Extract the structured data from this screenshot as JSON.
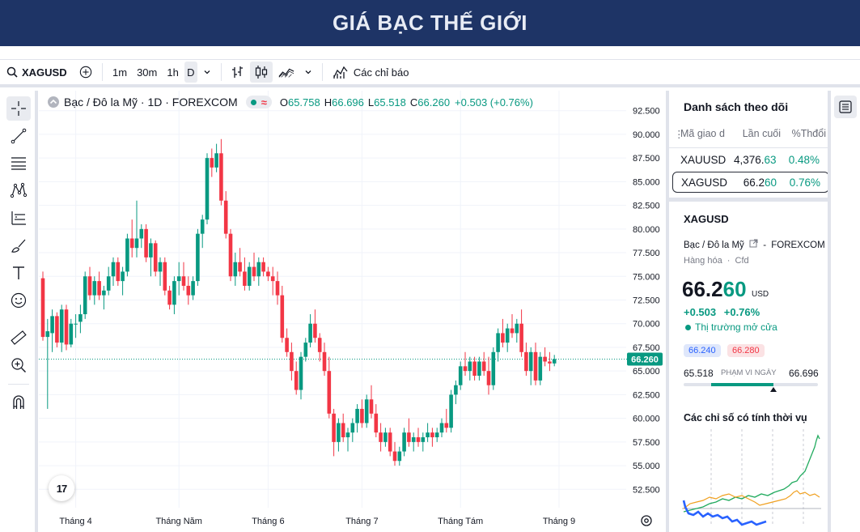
{
  "banner": {
    "title": "GIÁ BẠC THẾ GIỚI"
  },
  "toolbar": {
    "symbol": "XAGUSD",
    "intervals": [
      "1m",
      "30m",
      "1h",
      "D"
    ],
    "active_interval": "D",
    "indicators_label": "Các chỉ báo"
  },
  "legend": {
    "name": "Bạc / Đô la Mỹ · 1D · FOREXCOM",
    "o_label": "O",
    "o": "65.758",
    "h_label": "H",
    "h": "66.696",
    "l_label": "L",
    "l": "65.518",
    "c_label": "C",
    "c": "66.260",
    "change": "+0.503 (+0.76%)"
  },
  "colors": {
    "up": "#089981",
    "down": "#f23645",
    "banner": "#1e3466",
    "accent": "#2962ff"
  },
  "chart_data": {
    "type": "candlestick",
    "y_ticks": [
      "92.500",
      "90.000",
      "87.500",
      "85.000",
      "82.500",
      "80.000",
      "77.500",
      "75.000",
      "72.500",
      "70.000",
      "67.500",
      "65.000",
      "62.500",
      "60.000",
      "57.500",
      "55.000",
      "52.500"
    ],
    "ylim": [
      51.5,
      93.5
    ],
    "x_ticks": [
      "Tháng 4",
      "Tháng Năm",
      "Tháng 6",
      "Tháng 7",
      "Tháng Tám",
      "Tháng 9"
    ],
    "x_tick_index": [
      7,
      29,
      48,
      68,
      89,
      110
    ],
    "last_price": "66.260",
    "last_value": 66.26,
    "grid": true,
    "ohlc": [
      [
        74.8,
        75.5,
        68.2,
        68.6
      ],
      [
        68.6,
        70.5,
        61.0,
        69.2
      ],
      [
        69.0,
        71.5,
        67.0,
        70.8
      ],
      [
        70.8,
        71.2,
        67.5,
        68.0
      ],
      [
        68.0,
        72.0,
        67.0,
        71.5
      ],
      [
        71.5,
        72.0,
        67.2,
        67.8
      ],
      [
        67.8,
        70.5,
        67.5,
        70.0
      ],
      [
        70.0,
        71.0,
        68.5,
        70.0
      ],
      [
        70.2,
        72.0,
        69.0,
        71.0
      ],
      [
        71.0,
        75.5,
        70.5,
        75.0
      ],
      [
        75.0,
        76.0,
        72.5,
        73.0
      ],
      [
        73.0,
        75.0,
        72.0,
        74.5
      ],
      [
        74.5,
        75.5,
        72.5,
        73.0
      ],
      [
        73.0,
        74.0,
        71.5,
        73.5
      ],
      [
        73.5,
        76.0,
        73.0,
        75.0
      ],
      [
        75.0,
        77.0,
        74.0,
        76.5
      ],
      [
        76.5,
        77.0,
        74.0,
        74.5
      ],
      [
        74.5,
        76.0,
        73.0,
        75.5
      ],
      [
        75.5,
        79.5,
        75.0,
        79.0
      ],
      [
        79.0,
        81.0,
        77.0,
        78.0
      ],
      [
        78.0,
        83.0,
        77.0,
        79.0
      ],
      [
        79.0,
        80.5,
        78.0,
        80.0
      ],
      [
        80.0,
        80.5,
        76.5,
        77.0
      ],
      [
        77.0,
        79.0,
        75.0,
        78.5
      ],
      [
        78.5,
        78.8,
        75.0,
        75.5
      ],
      [
        75.5,
        77.0,
        74.0,
        76.5
      ],
      [
        76.5,
        77.0,
        73.0,
        73.5
      ],
      [
        73.5,
        74.0,
        71.5,
        72.0
      ],
      [
        72.0,
        75.0,
        71.0,
        74.5
      ],
      [
        74.5,
        76.5,
        73.0,
        75.0
      ],
      [
        75.0,
        76.5,
        73.5,
        74.0
      ],
      [
        74.0,
        75.0,
        72.0,
        73.0
      ],
      [
        73.0,
        75.0,
        72.5,
        74.5
      ],
      [
        74.5,
        80.0,
        74.0,
        79.5
      ],
      [
        79.5,
        81.5,
        78.0,
        81.0
      ],
      [
        81.0,
        88.0,
        80.5,
        87.5
      ],
      [
        87.5,
        88.5,
        85.5,
        86.5
      ],
      [
        86.5,
        89.0,
        86.0,
        88.0
      ],
      [
        88.0,
        89.5,
        82.5,
        83.0
      ],
      [
        83.0,
        84.0,
        79.0,
        79.5
      ],
      [
        79.5,
        80.0,
        74.5,
        75.0
      ],
      [
        75.0,
        77.5,
        74.0,
        76.5
      ],
      [
        76.5,
        78.0,
        75.0,
        75.5
      ],
      [
        75.5,
        77.0,
        73.5,
        74.0
      ],
      [
        74.0,
        76.5,
        73.5,
        76.0
      ],
      [
        76.0,
        77.5,
        74.5,
        75.0
      ],
      [
        75.0,
        77.0,
        74.0,
        76.5
      ],
      [
        76.5,
        77.0,
        75.0,
        75.5
      ],
      [
        75.5,
        76.0,
        74.5,
        75.0
      ],
      [
        75.0,
        76.0,
        73.0,
        74.5
      ],
      [
        74.5,
        75.5,
        72.0,
        73.0
      ],
      [
        73.0,
        74.0,
        68.0,
        68.5
      ],
      [
        68.5,
        69.5,
        66.5,
        67.0
      ],
      [
        67.0,
        68.0,
        64.0,
        65.0
      ],
      [
        65.0,
        66.0,
        62.5,
        63.0
      ],
      [
        63.0,
        67.0,
        62.0,
        66.5
      ],
      [
        66.5,
        68.5,
        66.0,
        68.0
      ],
      [
        68.0,
        71.0,
        67.5,
        70.0
      ],
      [
        70.0,
        71.5,
        68.0,
        68.5
      ],
      [
        68.5,
        69.0,
        66.0,
        67.0
      ],
      [
        67.0,
        68.0,
        64.5,
        65.0
      ],
      [
        65.0,
        66.5,
        60.0,
        60.5
      ],
      [
        60.5,
        61.0,
        56.0,
        57.5
      ],
      [
        57.5,
        60.0,
        56.5,
        59.5
      ],
      [
        59.5,
        60.5,
        57.5,
        58.0
      ],
      [
        58.0,
        59.0,
        56.5,
        58.5
      ],
      [
        58.5,
        60.0,
        57.5,
        59.5
      ],
      [
        59.5,
        61.5,
        58.5,
        61.0
      ],
      [
        61.0,
        62.0,
        59.0,
        59.5
      ],
      [
        59.5,
        62.5,
        59.0,
        62.0
      ],
      [
        62.0,
        63.5,
        60.0,
        60.5
      ],
      [
        60.5,
        61.5,
        58.0,
        58.5
      ],
      [
        58.5,
        59.5,
        56.5,
        57.5
      ],
      [
        57.5,
        59.0,
        57.0,
        58.5
      ],
      [
        58.5,
        59.0,
        56.0,
        56.5
      ],
      [
        56.5,
        57.5,
        55.0,
        55.5
      ],
      [
        55.5,
        57.0,
        55.0,
        56.5
      ],
      [
        56.5,
        59.0,
        56.0,
        58.5
      ],
      [
        58.5,
        60.0,
        57.0,
        57.5
      ],
      [
        57.5,
        58.5,
        56.5,
        58.0
      ],
      [
        58.0,
        59.0,
        57.0,
        57.5
      ],
      [
        57.5,
        58.5,
        56.5,
        58.0
      ],
      [
        58.0,
        59.5,
        57.5,
        58.5
      ],
      [
        58.5,
        59.0,
        57.0,
        58.0
      ],
      [
        58.0,
        59.0,
        57.5,
        58.5
      ],
      [
        58.5,
        60.0,
        58.0,
        59.5
      ],
      [
        59.5,
        61.0,
        58.5,
        59.0
      ],
      [
        59.0,
        63.0,
        58.5,
        62.5
      ],
      [
        62.5,
        64.0,
        61.5,
        63.5
      ],
      [
        63.5,
        66.0,
        63.0,
        65.5
      ],
      [
        65.5,
        67.0,
        64.5,
        65.0
      ],
      [
        65.0,
        66.5,
        64.0,
        66.0
      ],
      [
        66.0,
        66.5,
        64.0,
        64.5
      ],
      [
        64.5,
        66.5,
        64.0,
        66.0
      ],
      [
        66.0,
        67.0,
        64.5,
        65.0
      ],
      [
        65.0,
        66.5,
        62.5,
        63.5
      ],
      [
        63.5,
        67.5,
        63.0,
        67.0
      ],
      [
        67.0,
        69.5,
        66.0,
        69.0
      ],
      [
        69.0,
        70.5,
        67.5,
        68.0
      ],
      [
        68.0,
        70.0,
        67.0,
        69.5
      ],
      [
        69.5,
        71.0,
        68.5,
        69.0
      ],
      [
        69.0,
        70.5,
        68.0,
        70.0
      ],
      [
        70.0,
        71.5,
        66.5,
        67.0
      ],
      [
        67.0,
        68.0,
        64.5,
        65.0
      ],
      [
        65.0,
        67.5,
        63.5,
        67.0
      ],
      [
        67.0,
        68.0,
        63.5,
        64.0
      ],
      [
        64.0,
        67.0,
        63.5,
        66.5
      ],
      [
        66.5,
        67.5,
        65.5,
        66.0
      ],
      [
        66.0,
        67.0,
        65.0,
        65.8
      ],
      [
        65.8,
        66.7,
        65.5,
        66.26
      ]
    ]
  },
  "tv_logo": "17",
  "watchlist": {
    "title": "Danh sách theo dõi",
    "columns": [
      "Mã giao d",
      "Lần cuối",
      "%Thđổi"
    ],
    "rows": [
      {
        "symbol": "XAUUSD",
        "last_main": "4,376.",
        "last_tail": "63",
        "change": "0.48%"
      },
      {
        "symbol": "XAGUSD",
        "last_main": "66.2",
        "last_tail": "60",
        "change": "0.76%"
      }
    ]
  },
  "detail": {
    "symbol": "XAGUSD",
    "name": "Bạc / Đô la Mỹ",
    "exchange": "FOREXCOM",
    "category": "Hàng hóa",
    "kind": "Cfd",
    "price_main": "66.2",
    "price_tail": "60",
    "currency": "USD",
    "change": "+0.503",
    "change_pct": "+0.76%",
    "market_status": "Thị trường mở cửa",
    "bid": "66.240",
    "ask": "66.280",
    "range_low": "65.518",
    "range_label": "PHẠM VI NGÀY",
    "range_high": "66.696",
    "range_position": 0.63,
    "seasonal_title": "Các chỉ số có tính thời vụ"
  }
}
